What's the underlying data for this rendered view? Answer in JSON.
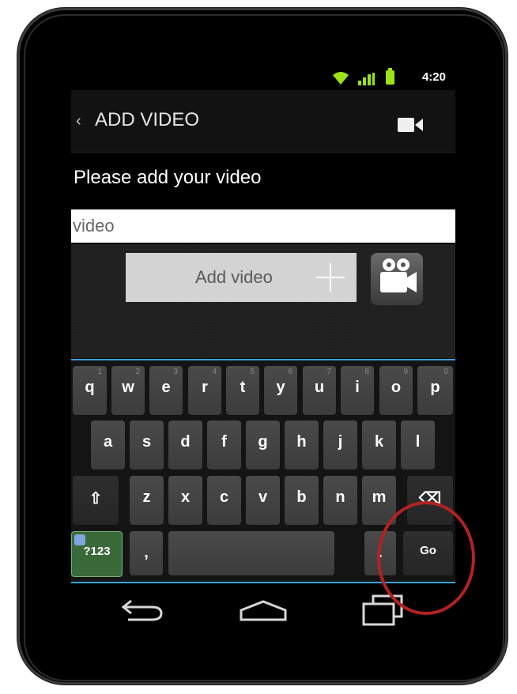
{
  "status_bar": {
    "time": "4:20",
    "icons": [
      "wifi-icon",
      "signal-icon",
      "battery-icon"
    ]
  },
  "action_bar": {
    "back_glyph": "‹",
    "title": "ADD VIDEO",
    "icon": "camcorder-icon"
  },
  "prompt": "Please add your video",
  "video_field": {
    "value": "video"
  },
  "add_video_button": {
    "label": "Add video",
    "icon": "plus-icon"
  },
  "video_camera_button": {
    "icon": "video-camera-icon"
  },
  "keyboard": {
    "row1": [
      {
        "label": "q",
        "hint": "1"
      },
      {
        "label": "w",
        "hint": "2"
      },
      {
        "label": "e",
        "hint": "3"
      },
      {
        "label": "r",
        "hint": "4"
      },
      {
        "label": "t",
        "hint": "5"
      },
      {
        "label": "y",
        "hint": "6"
      },
      {
        "label": "u",
        "hint": "7"
      },
      {
        "label": "i",
        "hint": "8"
      },
      {
        "label": "o",
        "hint": "9"
      },
      {
        "label": "p",
        "hint": "0"
      }
    ],
    "row2": [
      "a",
      "s",
      "d",
      "f",
      "g",
      "h",
      "j",
      "k",
      "l"
    ],
    "row3": [
      "z",
      "x",
      "c",
      "v",
      "b",
      "n",
      "m"
    ],
    "shift_glyph": "⇧",
    "backspace_glyph": "⌫",
    "symbols_label": "?123",
    "comma_label": ",",
    "period_label": ".",
    "go_label": "Go"
  },
  "nav_bar": {
    "icons": [
      "back-icon",
      "home-icon",
      "recent-apps-icon"
    ]
  },
  "colors": {
    "keyboard_accent": "#35a6d6",
    "highlight": "#b22222",
    "battery": "#9be316"
  }
}
